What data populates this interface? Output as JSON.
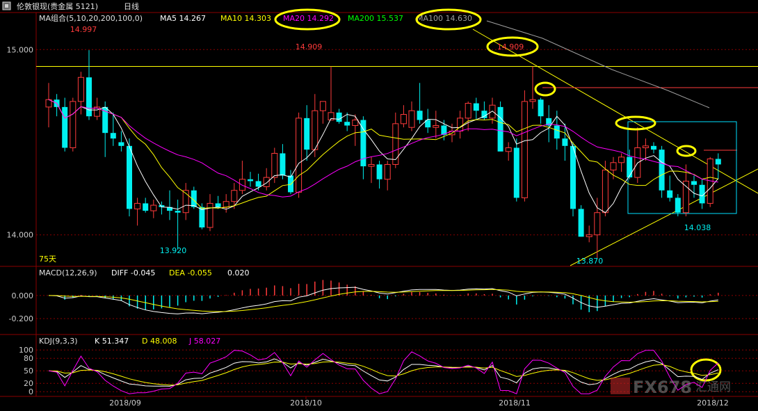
{
  "window": {
    "title": "伦敦银现(贵金属 5121)",
    "period": "日线"
  },
  "colors": {
    "up": "#ff3b3b",
    "down": "#00f0f0",
    "ma5": "#ffffff",
    "ma10": "#ffff00",
    "ma20": "#ff00ff",
    "ma200": "#00ff00",
    "ma100": "#a0a0a0",
    "grid": "#8b0000",
    "frame": "#8b0000",
    "axis_text": "#cccccc",
    "trendline": "#ffff00",
    "annotation": "#ffff00",
    "box": "#00e0ff"
  },
  "main_legend": {
    "name": "MA组合(5,10,20,200,100,0)",
    "ma5": "MA5 14.267",
    "ma10": "MA10 14.303",
    "ma20": "MA20 14.292",
    "ma200": "MA200 15.537",
    "ma100": "MA100 14.630"
  },
  "macd_legend": {
    "name": "MACD(12,26,9)",
    "diff": "DIFF -0.045",
    "dea": "DEA -0.055",
    "macd": "0.020"
  },
  "kdj_legend": {
    "name": "KDJ(9,3,3)",
    "k": "K 51.347",
    "d": "D 48.008",
    "j": "J 58.027"
  },
  "labels": {
    "days": "75天",
    "watermark": "FX678",
    "watermark_cn": "汇通网"
  },
  "chart_data": {
    "type": "candlestick",
    "x_ticks": [
      "2018/09",
      "2018/10",
      "2018/11",
      "2018/12"
    ],
    "price_axis": {
      "ticks": [
        "15.000",
        "14.000"
      ],
      "ylim": [
        13.83,
        15.2
      ]
    },
    "annotations": [
      "14.997",
      "14.909",
      "14.909",
      "13.920",
      "13.870",
      "14.038"
    ],
    "candles": [
      [
        14.69,
        14.82,
        14.58,
        14.73
      ],
      [
        14.73,
        14.76,
        14.64,
        14.69
      ],
      [
        14.69,
        14.74,
        14.45,
        14.47
      ],
      [
        14.47,
        14.74,
        14.45,
        14.72
      ],
      [
        14.72,
        14.88,
        14.65,
        14.85
      ],
      [
        14.85,
        14.997,
        14.62,
        14.64
      ],
      [
        14.64,
        14.74,
        14.62,
        14.69
      ],
      [
        14.69,
        14.72,
        14.42,
        14.55
      ],
      [
        14.55,
        14.66,
        14.48,
        14.52
      ],
      [
        14.5,
        14.56,
        14.45,
        14.48
      ],
      [
        14.48,
        14.52,
        14.1,
        14.14
      ],
      [
        14.14,
        14.2,
        14.05,
        14.17
      ],
      [
        14.17,
        14.2,
        14.12,
        14.13
      ],
      [
        14.13,
        14.19,
        14.09,
        14.16
      ],
      [
        14.16,
        14.18,
        14.11,
        14.15
      ],
      [
        14.15,
        14.24,
        14.08,
        14.13
      ],
      [
        14.13,
        14.19,
        13.92,
        14.12
      ],
      [
        14.12,
        14.28,
        14.08,
        14.24
      ],
      [
        14.24,
        14.26,
        14.14,
        14.15
      ],
      [
        14.15,
        14.17,
        14.03,
        14.04
      ],
      [
        14.04,
        14.22,
        14.02,
        14.17
      ],
      [
        14.17,
        14.21,
        14.14,
        14.15
      ],
      [
        14.15,
        14.22,
        14.12,
        14.18
      ],
      [
        14.18,
        14.28,
        14.14,
        14.24
      ],
      [
        14.24,
        14.4,
        14.22,
        14.3
      ],
      [
        14.3,
        14.34,
        14.26,
        14.29
      ],
      [
        14.29,
        14.33,
        14.24,
        14.26
      ],
      [
        14.26,
        14.36,
        14.24,
        14.31
      ],
      [
        14.31,
        14.47,
        14.28,
        14.44
      ],
      [
        14.44,
        14.49,
        14.3,
        14.32
      ],
      [
        14.32,
        14.35,
        14.22,
        14.23
      ],
      [
        14.23,
        14.66,
        14.2,
        14.63
      ],
      [
        14.63,
        14.7,
        14.4,
        14.46
      ],
      [
        14.46,
        14.76,
        14.42,
        14.67
      ],
      [
        14.67,
        14.72,
        14.6,
        14.72
      ],
      [
        14.62,
        14.909,
        14.62,
        14.66
      ],
      [
        14.66,
        14.68,
        14.6,
        14.61
      ],
      [
        14.61,
        14.66,
        14.56,
        14.59
      ],
      [
        14.59,
        14.65,
        14.48,
        14.62
      ],
      [
        14.62,
        14.64,
        14.3,
        14.37
      ],
      [
        14.37,
        14.42,
        14.28,
        14.38
      ],
      [
        14.38,
        14.4,
        14.25,
        14.3
      ],
      [
        14.3,
        14.4,
        14.24,
        14.38
      ],
      [
        14.38,
        14.66,
        14.36,
        14.6
      ],
      [
        14.6,
        14.7,
        14.58,
        14.65
      ],
      [
        14.58,
        14.72,
        14.56,
        14.67
      ],
      [
        14.67,
        14.82,
        14.6,
        14.62
      ],
      [
        14.62,
        14.68,
        14.55,
        14.58
      ],
      [
        14.58,
        14.67,
        14.52,
        14.59
      ],
      [
        14.59,
        14.62,
        14.51,
        14.54
      ],
      [
        14.54,
        14.6,
        14.5,
        14.56
      ],
      [
        14.56,
        14.67,
        14.52,
        14.63
      ],
      [
        14.63,
        14.72,
        14.56,
        14.71
      ],
      [
        14.71,
        14.74,
        14.62,
        14.67
      ],
      [
        14.67,
        14.72,
        14.62,
        14.63
      ],
      [
        14.63,
        14.74,
        14.6,
        14.7
      ],
      [
        14.69,
        14.72,
        14.52,
        14.45
      ],
      [
        14.45,
        14.5,
        14.4,
        14.47
      ],
      [
        14.47,
        14.52,
        14.18,
        14.2
      ],
      [
        14.2,
        14.78,
        14.18,
        14.72
      ],
      [
        14.72,
        14.909,
        14.68,
        14.73
      ],
      [
        14.73,
        14.74,
        14.6,
        14.64
      ],
      [
        14.63,
        14.7,
        14.5,
        14.59
      ],
      [
        14.59,
        14.67,
        14.46,
        14.52
      ],
      [
        14.52,
        14.6,
        14.4,
        14.48
      ],
      [
        14.48,
        14.5,
        14.1,
        14.14
      ],
      [
        14.14,
        14.16,
        13.99,
        13.99
      ],
      [
        13.99,
        14.05,
        13.96,
        14.0
      ],
      [
        14.0,
        14.2,
        13.87,
        14.12
      ],
      [
        14.12,
        14.4,
        14.1,
        14.35
      ],
      [
        14.35,
        14.42,
        14.3,
        14.39
      ],
      [
        14.39,
        14.44,
        14.34,
        14.42
      ],
      [
        14.42,
        14.46,
        14.3,
        14.31
      ],
      [
        14.31,
        14.58,
        14.28,
        14.47
      ],
      [
        14.47,
        14.52,
        14.4,
        14.48
      ],
      [
        14.48,
        14.5,
        14.44,
        14.46
      ],
      [
        14.46,
        14.48,
        14.2,
        14.24
      ],
      [
        14.24,
        14.32,
        14.18,
        14.2
      ],
      [
        14.2,
        14.22,
        14.1,
        14.12
      ],
      [
        14.12,
        14.38,
        14.1,
        14.29
      ],
      [
        14.29,
        14.32,
        14.2,
        14.27
      ],
      [
        14.27,
        14.3,
        14.14,
        14.17
      ],
      [
        14.17,
        14.42,
        14.15,
        14.41
      ],
      [
        14.41,
        14.44,
        14.3,
        14.38
      ]
    ],
    "macd_axis": {
      "ticks": [
        "0.000",
        "-0.200"
      ],
      "ylim": [
        -0.32,
        0.15
      ]
    },
    "kdj_axis": {
      "ticks": [
        "100",
        "80",
        "50",
        "20",
        "0"
      ],
      "ylim": [
        -8,
        112
      ]
    }
  }
}
